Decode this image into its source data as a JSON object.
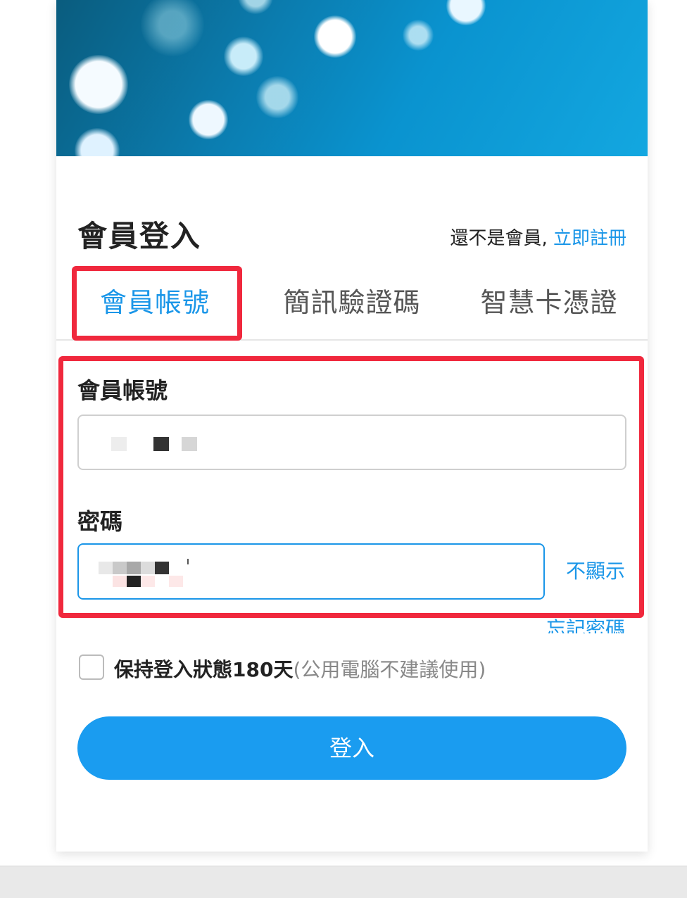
{
  "header": {
    "title": "會員登入",
    "register_prompt": "還不是會員,",
    "register_link": "立即註冊"
  },
  "tabs": [
    {
      "label": "會員帳號",
      "active": true
    },
    {
      "label": "簡訊驗證碼",
      "active": false
    },
    {
      "label": "智慧卡憑證",
      "active": false
    }
  ],
  "form": {
    "account_label": "會員帳號",
    "password_label": "密碼",
    "show_password": "不顯示",
    "forgot_password": "忘記密碼"
  },
  "keep_login": {
    "label": "保持登入狀態180天",
    "note": "(公用電腦不建議使用)",
    "checked": false
  },
  "login_button": "登入",
  "colors": {
    "accent": "#1a96e8",
    "highlight": "#f0283d",
    "button": "#1a9cf0"
  }
}
